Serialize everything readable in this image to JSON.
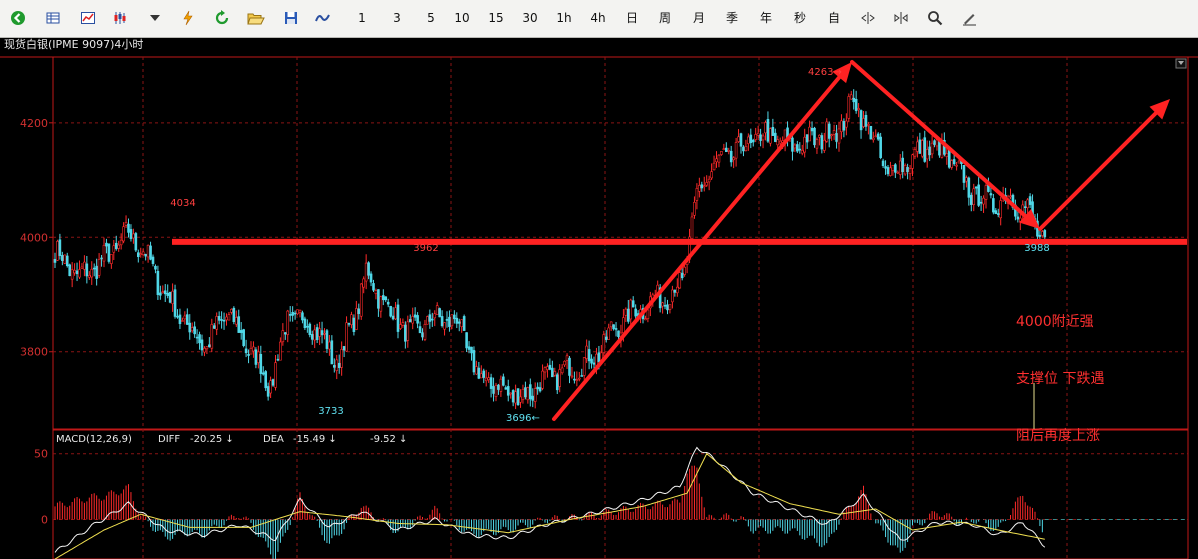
{
  "toolbar": {
    "buttons": [
      {
        "name": "back-icon"
      },
      {
        "name": "list-view-icon"
      },
      {
        "name": "line-chart-icon"
      },
      {
        "name": "candle-chart-icon"
      },
      {
        "name": "dropdown-arrow-icon"
      },
      {
        "name": "lightning-icon"
      },
      {
        "name": "refresh-icon"
      },
      {
        "name": "open-folder-icon"
      },
      {
        "name": "save-icon"
      },
      {
        "name": "indicator-wave-icon"
      }
    ],
    "periods": [
      "1",
      "3",
      "5",
      "10",
      "15",
      "30",
      "1h",
      "4h",
      "日",
      "周",
      "月",
      "季",
      "年",
      "秒",
      "自"
    ],
    "tools": [
      {
        "name": "zoom-out-icon"
      },
      {
        "name": "zoom-in-icon"
      },
      {
        "name": "search-icon"
      },
      {
        "name": "draw-pen-icon"
      }
    ]
  },
  "chart": {
    "title": "现货白银(IPME 9097)4小时",
    "accent_color": "#ff2222",
    "up_color": "#ff2a2a",
    "down_color": "#50d8e8",
    "axis_color": "#c01818"
  },
  "chart_data": [
    {
      "type": "candlestick",
      "title": "现货白银(IPME 9097)4小时",
      "y_ticks": [
        4200,
        4000,
        3800
      ],
      "ylim": [
        3665,
        4315
      ],
      "grid": true,
      "labels": [
        {
          "text": "4034",
          "value": 4034
        },
        {
          "text": "3962",
          "value": 3962
        },
        {
          "text": "3733",
          "value": 3733
        },
        {
          "text": "3696←",
          "value": 3696
        },
        {
          "text": "4263→",
          "value": 4263
        },
        {
          "text": "3988",
          "value": 3988
        }
      ],
      "support_level": 3992,
      "annotation": [
        "4000附近强",
        "支撑位 下跌遇",
        "阻后再度上涨"
      ],
      "path_points": [
        {
          "bar": 0,
          "close": 3975
        },
        {
          "bar": 10,
          "close": 3930
        },
        {
          "bar": 20,
          "close": 3960
        },
        {
          "bar": 30,
          "close": 4005
        },
        {
          "bar": 35,
          "close": 3985
        },
        {
          "bar": 45,
          "close": 3900
        },
        {
          "bar": 55,
          "close": 3840
        },
        {
          "bar": 62,
          "close": 3810
        },
        {
          "bar": 70,
          "close": 3870
        },
        {
          "bar": 80,
          "close": 3800
        },
        {
          "bar": 88,
          "close": 3740
        },
        {
          "bar": 95,
          "close": 3860
        },
        {
          "bar": 105,
          "close": 3850
        },
        {
          "bar": 115,
          "close": 3780
        },
        {
          "bar": 123,
          "close": 3870
        },
        {
          "bar": 127,
          "close": 3940
        },
        {
          "bar": 135,
          "close": 3880
        },
        {
          "bar": 145,
          "close": 3830
        },
        {
          "bar": 155,
          "close": 3860
        },
        {
          "bar": 165,
          "close": 3850
        },
        {
          "bar": 172,
          "close": 3760
        },
        {
          "bar": 180,
          "close": 3740
        },
        {
          "bar": 190,
          "close": 3720
        },
        {
          "bar": 200,
          "close": 3750
        },
        {
          "bar": 210,
          "close": 3770
        },
        {
          "bar": 220,
          "close": 3790
        },
        {
          "bar": 230,
          "close": 3850
        },
        {
          "bar": 240,
          "close": 3880
        },
        {
          "bar": 250,
          "close": 3900
        },
        {
          "bar": 256,
          "close": 3920
        },
        {
          "bar": 262,
          "close": 4070
        },
        {
          "bar": 268,
          "close": 4120
        },
        {
          "bar": 278,
          "close": 4150
        },
        {
          "bar": 290,
          "close": 4180
        },
        {
          "bar": 300,
          "close": 4160
        },
        {
          "bar": 310,
          "close": 4170
        },
        {
          "bar": 320,
          "close": 4190
        },
        {
          "bar": 326,
          "close": 4240
        },
        {
          "bar": 333,
          "close": 4180
        },
        {
          "bar": 340,
          "close": 4110
        },
        {
          "bar": 350,
          "close": 4140
        },
        {
          "bar": 358,
          "close": 4160
        },
        {
          "bar": 366,
          "close": 4130
        },
        {
          "bar": 374,
          "close": 4080
        },
        {
          "bar": 382,
          "close": 4060
        },
        {
          "bar": 390,
          "close": 4070
        },
        {
          "bar": 398,
          "close": 4040
        },
        {
          "bar": 404,
          "close": 3990
        }
      ]
    },
    {
      "type": "bar",
      "title": "MACD(12,26,9)",
      "y_ticks": [
        50,
        0
      ],
      "ylim": [
        -30,
        68
      ],
      "readouts": {
        "macd_label": "MACD(12,26,9)",
        "diff_label": "DIFF",
        "diff_value": "-20.25 ↓",
        "dea_label": "DEA",
        "dea_value": "-15.49 ↓",
        "macd_value": "-9.52 ↓"
      },
      "diff_path": [
        {
          "bar": 0,
          "value": -25
        },
        {
          "bar": 15,
          "value": -5
        },
        {
          "bar": 30,
          "value": 12
        },
        {
          "bar": 45,
          "value": -8
        },
        {
          "bar": 60,
          "value": -12
        },
        {
          "bar": 75,
          "value": -4
        },
        {
          "bar": 90,
          "value": -15
        },
        {
          "bar": 100,
          "value": 15
        },
        {
          "bar": 112,
          "value": -6
        },
        {
          "bar": 125,
          "value": 6
        },
        {
          "bar": 140,
          "value": -8
        },
        {
          "bar": 155,
          "value": 0
        },
        {
          "bar": 170,
          "value": -12
        },
        {
          "bar": 185,
          "value": -14
        },
        {
          "bar": 200,
          "value": -4
        },
        {
          "bar": 220,
          "value": 5
        },
        {
          "bar": 240,
          "value": 15
        },
        {
          "bar": 255,
          "value": 25
        },
        {
          "bar": 262,
          "value": 55
        },
        {
          "bar": 270,
          "value": 45
        },
        {
          "bar": 285,
          "value": 20
        },
        {
          "bar": 300,
          "value": 8
        },
        {
          "bar": 315,
          "value": -4
        },
        {
          "bar": 330,
          "value": 18
        },
        {
          "bar": 345,
          "value": -16
        },
        {
          "bar": 360,
          "value": -2
        },
        {
          "bar": 375,
          "value": -4
        },
        {
          "bar": 385,
          "value": -12
        },
        {
          "bar": 395,
          "value": -2
        },
        {
          "bar": 404,
          "value": -20
        }
      ],
      "dea_path": [
        {
          "bar": 0,
          "value": -30
        },
        {
          "bar": 20,
          "value": -8
        },
        {
          "bar": 35,
          "value": 4
        },
        {
          "bar": 55,
          "value": -6
        },
        {
          "bar": 80,
          "value": -6
        },
        {
          "bar": 100,
          "value": 6
        },
        {
          "bar": 120,
          "value": 2
        },
        {
          "bar": 140,
          "value": -3
        },
        {
          "bar": 160,
          "value": -4
        },
        {
          "bar": 185,
          "value": -10
        },
        {
          "bar": 210,
          "value": 0
        },
        {
          "bar": 240,
          "value": 10
        },
        {
          "bar": 258,
          "value": 20
        },
        {
          "bar": 266,
          "value": 50
        },
        {
          "bar": 280,
          "value": 28
        },
        {
          "bar": 300,
          "value": 12
        },
        {
          "bar": 320,
          "value": 4
        },
        {
          "bar": 335,
          "value": 8
        },
        {
          "bar": 350,
          "value": -8
        },
        {
          "bar": 370,
          "value": -2
        },
        {
          "bar": 385,
          "value": -8
        },
        {
          "bar": 404,
          "value": -15
        }
      ]
    }
  ]
}
